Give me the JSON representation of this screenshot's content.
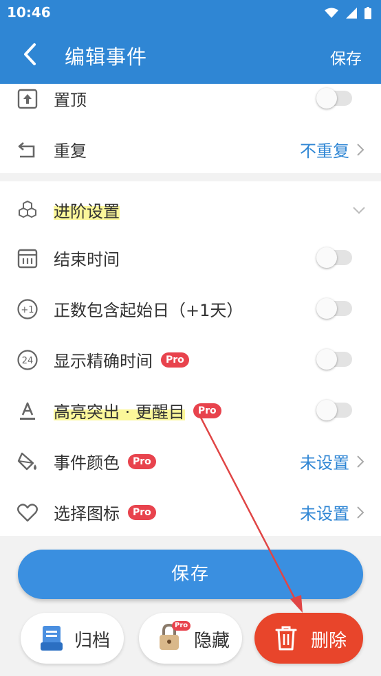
{
  "status_bar": {
    "time": "10:46"
  },
  "header": {
    "title": "编辑事件",
    "save_label": "保存"
  },
  "basic": [
    {
      "label": "置顶",
      "icon": "pin-top-icon",
      "toggle": false
    },
    {
      "label": "重复",
      "icon": "repeat-icon",
      "value": "不重复"
    }
  ],
  "advanced": {
    "title": "进阶设置",
    "items": [
      {
        "label": "结束时间",
        "icon": "calendar-icon",
        "toggle": false
      },
      {
        "label": "正数包含起始日（+1天）",
        "icon": "plus-one-icon",
        "toggle": false
      },
      {
        "label": "显示精确时间",
        "icon": "clock-24-icon",
        "pro": "Pro",
        "toggle": false
      },
      {
        "label": "高亮突出 · 更醒目",
        "icon": "text-highlight-icon",
        "pro": "Pro",
        "toggle": false
      },
      {
        "label": "事件颜色",
        "icon": "paint-bucket-icon",
        "pro": "Pro",
        "value": "未设置"
      },
      {
        "label": "选择图标",
        "icon": "heart-icon",
        "pro": "Pro",
        "value": "未设置"
      }
    ]
  },
  "actions": {
    "save": "保存",
    "archive": "归档",
    "hide": "隐藏",
    "hide_pro": "Pro",
    "delete": "删除"
  }
}
